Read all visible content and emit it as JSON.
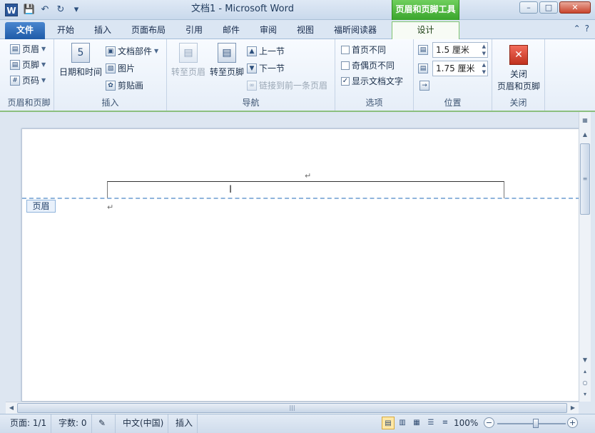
{
  "window": {
    "title": "文档1 - Microsoft Word",
    "context_tab_title": "页眉和页脚工具",
    "app_icon_letter": "W",
    "controls": {
      "minimize": "–",
      "maximize": "□",
      "close": "✕"
    }
  },
  "qat": {
    "save_icon": "💾",
    "undo_icon": "↶",
    "redo_icon": "↻",
    "customize_icon": "▾"
  },
  "tabs": {
    "file": "文件",
    "home": "开始",
    "insert": "插入",
    "layout": "页面布局",
    "references": "引用",
    "mailings": "邮件",
    "review": "审阅",
    "view": "视图",
    "foxit": "福昕阅读器",
    "design": "设计"
  },
  "ribbon_ctrl": {
    "collapse": "⌃",
    "help": "?"
  },
  "ribbon": {
    "hf": {
      "label": "页眉和页脚",
      "header": "页眉",
      "footer": "页脚",
      "page_number": "页码"
    },
    "insert": {
      "label": "插入",
      "datetime": "日期和时间",
      "datetime_icon_num": "5",
      "docparts": "文档部件",
      "picture": "图片",
      "clipart": "剪贴画"
    },
    "nav": {
      "label": "导航",
      "goto_header": "转至页眉",
      "goto_footer": "转至页脚",
      "previous": "上一节",
      "next": "下一节",
      "link_previous": "链接到前一条页眉"
    },
    "options": {
      "label": "选项",
      "diff_first": "首页不同",
      "diff_odd_even": "奇偶页不同",
      "show_doc_text": "显示文档文字",
      "show_doc_text_checked": "✓"
    },
    "position": {
      "label": "位置",
      "header_from_top": "1.5 厘米",
      "footer_from_bottom": "1.75 厘米"
    },
    "close": {
      "label": "关闭",
      "button_line1": "关闭",
      "button_line2": "页眉和页脚",
      "icon": "✕"
    }
  },
  "document": {
    "header_tag": "页眉",
    "paragraph_mark": "↵",
    "cursor": "I"
  },
  "statusbar": {
    "page": "页面: 1/1",
    "words": "字数: 0",
    "language": "中文(中国)",
    "mode": "插入",
    "zoom": "100%",
    "zoom_level_percent": 100
  },
  "colors": {
    "context_tab": "#3aa52c",
    "file_tab": "#2b65b5",
    "header_dashed": "#8fb4dc"
  }
}
